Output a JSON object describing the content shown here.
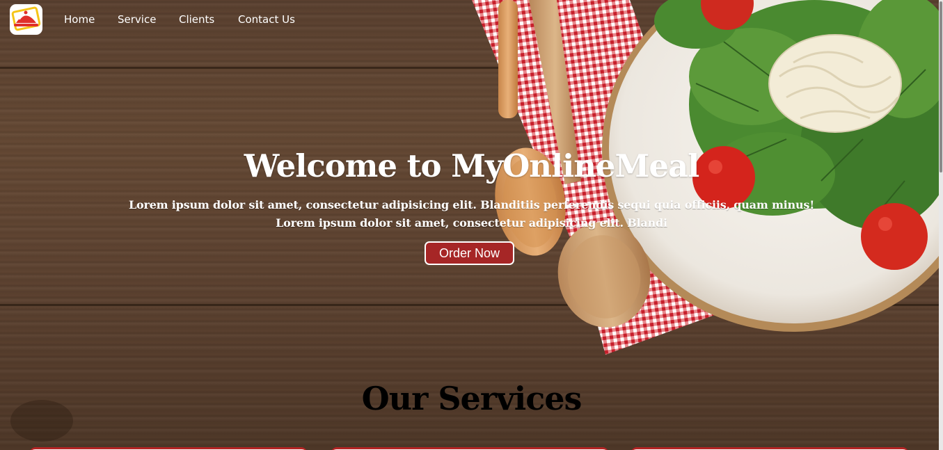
{
  "nav": {
    "logo_icon": "food-cloche-icon",
    "links": [
      "Home",
      "Service",
      "Clients",
      "Contact Us"
    ]
  },
  "hero": {
    "title": "Welcome to MyOnlineMeal",
    "text_line1": "Lorem ipsum dolor sit amet, consectetur adipisicing elit. Blanditiis perferendis sequi quia officiis, quam minus!",
    "text_line2": "Lorem ipsum dolor sit amet, consectetur adipisicing elit. Blandi",
    "button_label": "Order Now"
  },
  "services": {
    "title": "Our Services"
  },
  "colors": {
    "accent": "#a62626",
    "text_light": "#ffffff",
    "wood": "#5e4331"
  }
}
